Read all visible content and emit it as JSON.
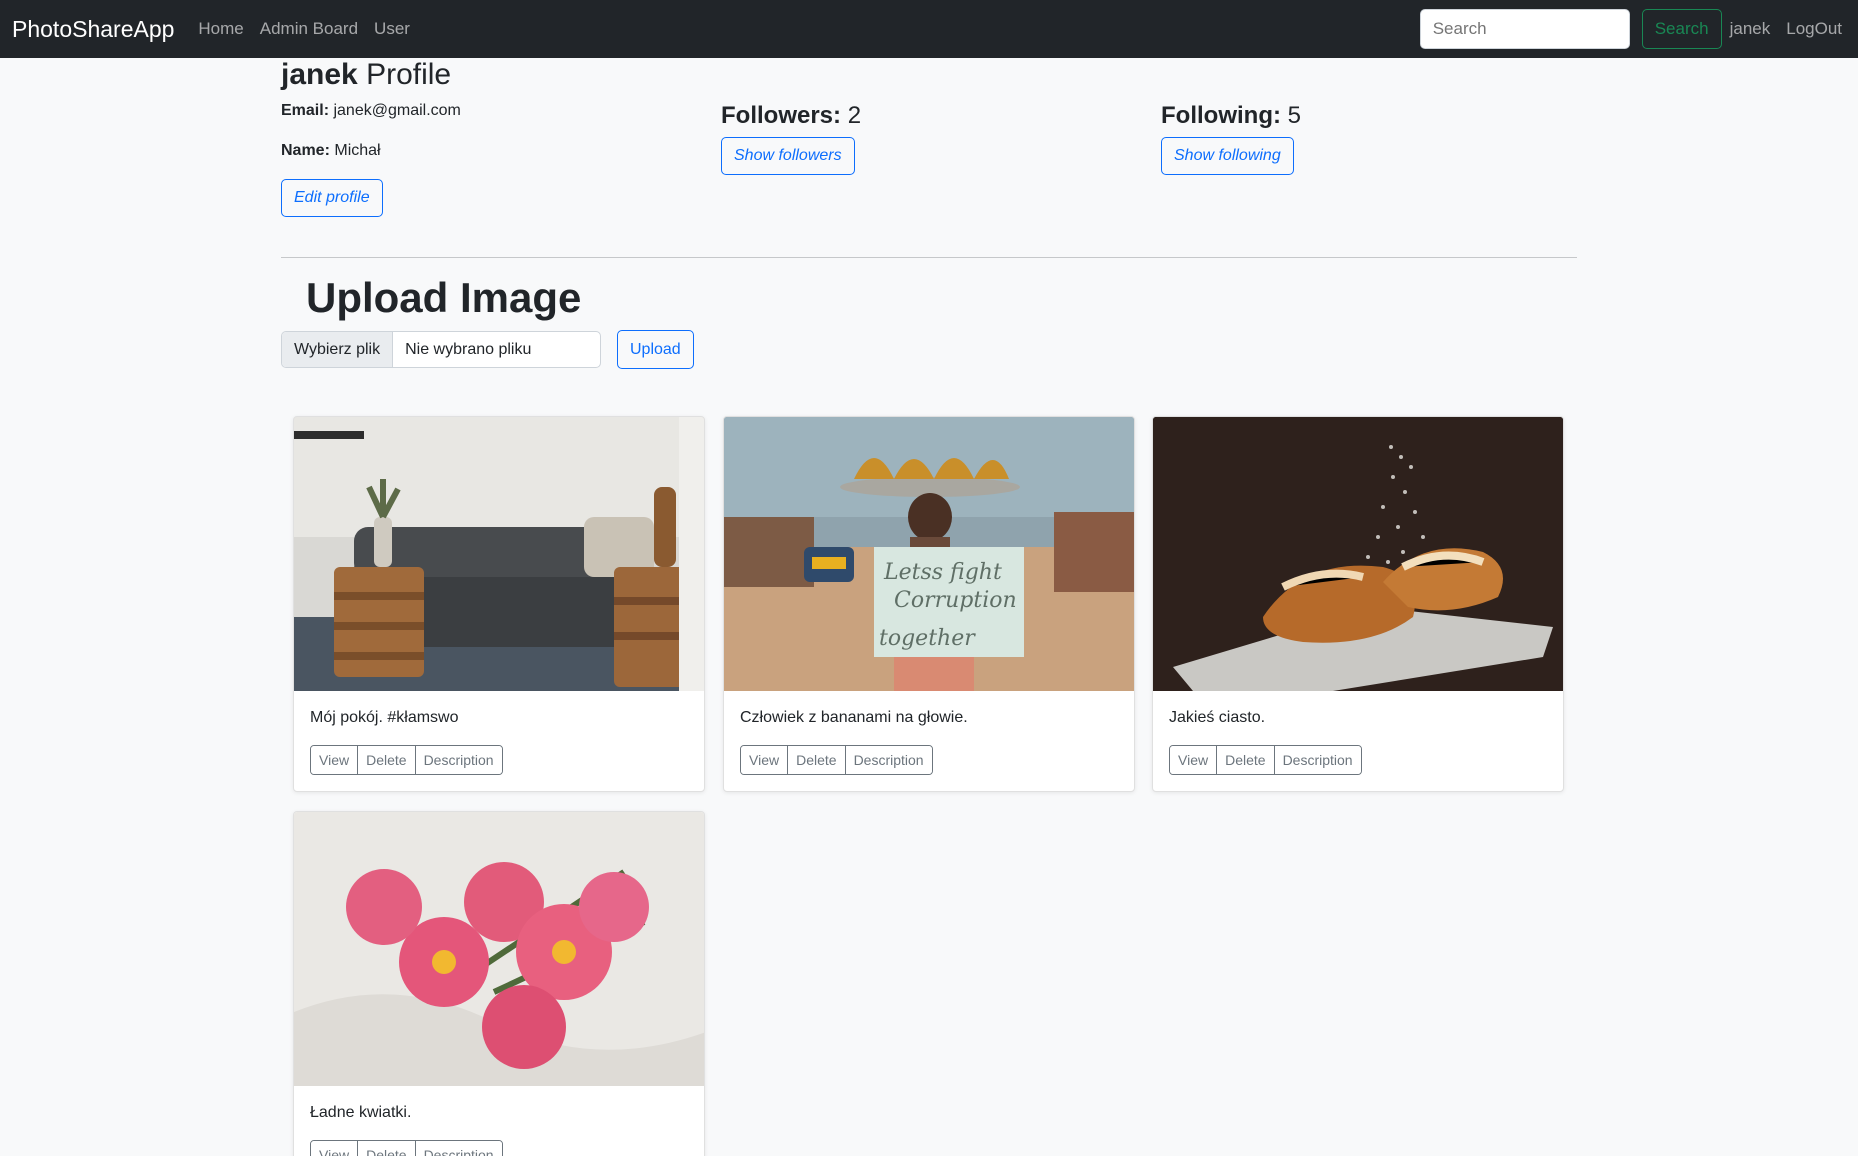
{
  "navbar": {
    "brand": "PhotoShareApp",
    "links": [
      "Home",
      "Admin Board",
      "User"
    ],
    "search_placeholder": "Search",
    "search_button": "Search",
    "username": "janek",
    "logout": "LogOut"
  },
  "profile": {
    "username": "janek",
    "title_suffix": "Profile",
    "email_label": "Email:",
    "email": "janek@gmail.com",
    "name_label": "Name:",
    "name": "Michał",
    "edit_button": "Edit profile",
    "followers_label": "Followers:",
    "followers_count": "2",
    "show_followers": "Show followers",
    "following_label": "Following:",
    "following_count": "5",
    "show_following": "Show following"
  },
  "upload": {
    "title": "Upload Image",
    "choose_label": "Wybierz plik",
    "file_status": "Nie wybrano pliku",
    "button": "Upload"
  },
  "photos": [
    {
      "description": "Mój pokój. #kłamswo",
      "view": "View",
      "delete": "Delete",
      "desc_button": "Description"
    },
    {
      "description": "Człowiek z bananami na głowie.",
      "view": "View",
      "delete": "Delete",
      "desc_button": "Description"
    },
    {
      "description": "Jakieś ciasto.",
      "view": "View",
      "delete": "Delete",
      "desc_button": "Description"
    },
    {
      "description": "Ładne kwiatki.",
      "view": "View",
      "delete": "Delete",
      "desc_button": "Description"
    }
  ]
}
